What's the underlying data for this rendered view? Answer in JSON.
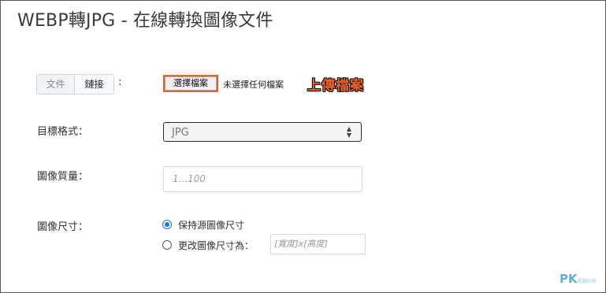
{
  "page": {
    "title": "WEBP轉JPG - 在線轉換圖像文件"
  },
  "source": {
    "tabs": [
      {
        "label": "文件",
        "active": false
      },
      {
        "label": "鏈接",
        "active": true
      }
    ],
    "colon": ":",
    "file_button_label": "選擇檔案",
    "file_status": "未選擇任何檔案",
    "annotation": "上傳檔案"
  },
  "format": {
    "label": "目標格式：",
    "selected": "JPG"
  },
  "quality": {
    "label": "圖像質量：",
    "placeholder": "1...100"
  },
  "size": {
    "label": "圖像尺寸：",
    "options": [
      {
        "label": "保持源圖像尺寸",
        "checked": true
      },
      {
        "label": "更改圖像尺寸為：",
        "checked": false
      }
    ],
    "dimension_placeholder": "[寬度]x[高度]"
  },
  "watermark": {
    "text": "PK",
    "subtext": "電腦玩物"
  },
  "colors": {
    "accent": "#e8602c",
    "radio": "#1a73e8",
    "watermark": "#5fb0d8"
  }
}
